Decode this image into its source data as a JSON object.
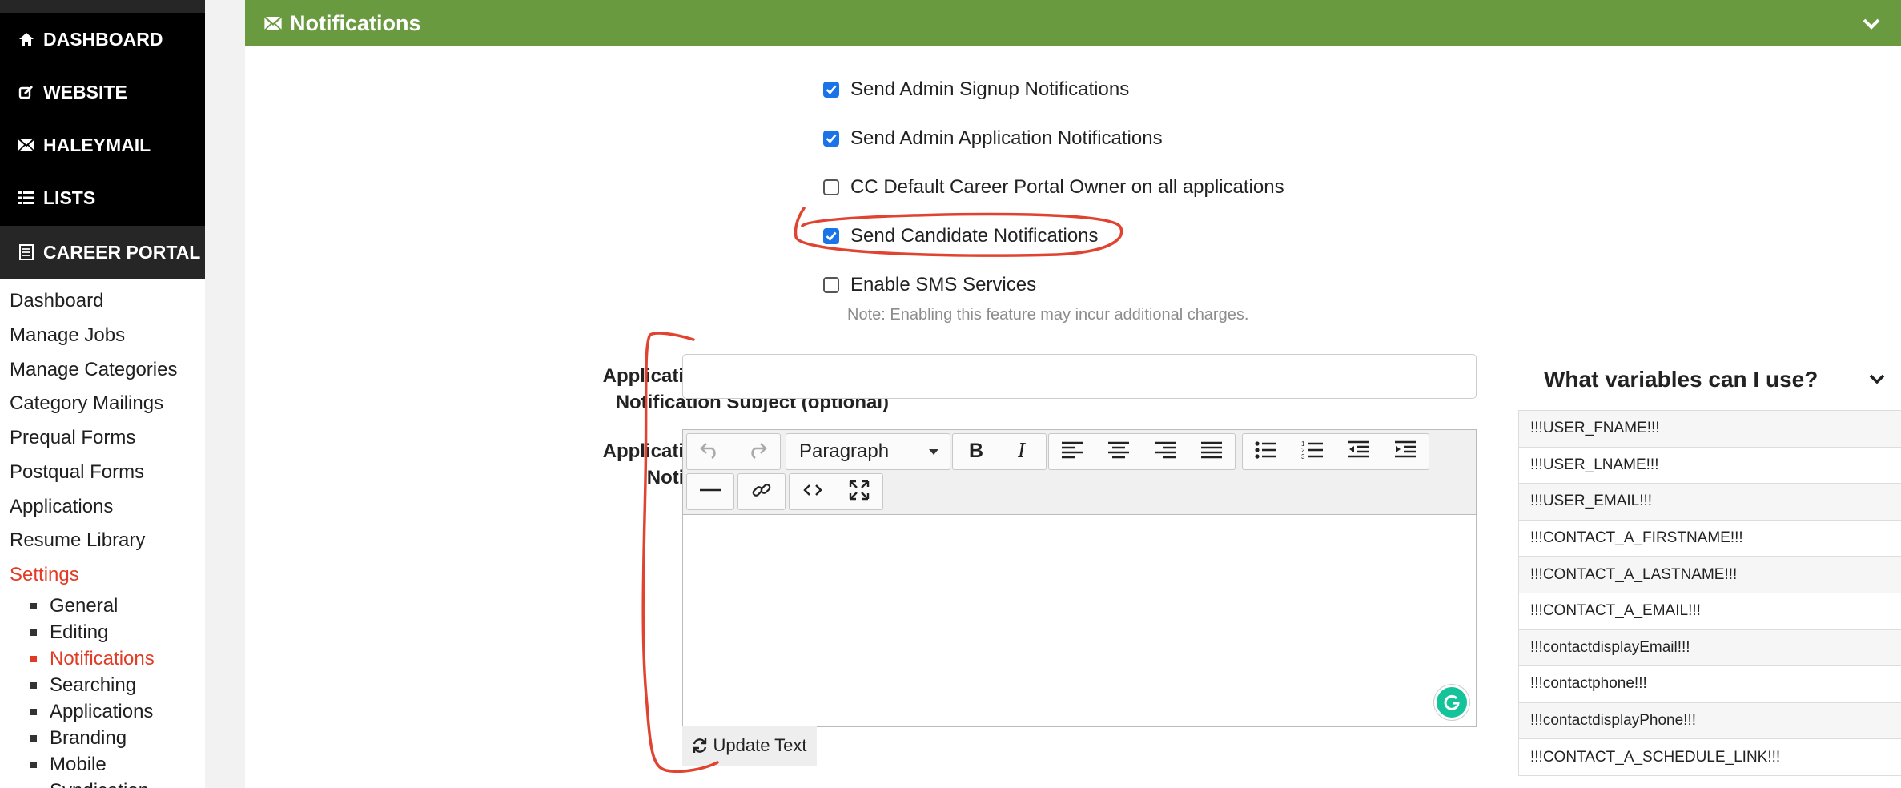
{
  "sidebar": {
    "main_nav": [
      {
        "label": "DASHBOARD",
        "icon": "home-icon"
      },
      {
        "label": "WEBSITE",
        "icon": "edit-icon"
      },
      {
        "label": "HALEYMAIL",
        "icon": "mail-icon"
      },
      {
        "label": "LISTS",
        "icon": "list-icon"
      },
      {
        "label": "CAREER PORTAL",
        "icon": "document-icon",
        "active": true
      }
    ],
    "sub_nav": [
      "Dashboard",
      "Manage Jobs",
      "Manage Categories",
      "Category Mailings",
      "Prequal Forms",
      "Postqual Forms",
      "Applications",
      "Resume Library",
      "Settings"
    ],
    "settings_items": [
      "General",
      "Editing",
      "Notifications",
      "Searching",
      "Applications",
      "Branding",
      "Mobile",
      "Syndication"
    ],
    "active_color": "#e23a24"
  },
  "panel": {
    "title": "Notifications",
    "header_color": "#6a9a40",
    "checkboxes": [
      {
        "label": "Send Admin Signup Notifications",
        "checked": true
      },
      {
        "label": "Send Admin Application Notifications",
        "checked": true
      },
      {
        "label": "CC Default Career Portal Owner on all applications",
        "checked": false
      },
      {
        "label": "Send Candidate Notifications",
        "checked": true
      },
      {
        "label": "Enable SMS Services",
        "checked": false
      }
    ],
    "sms_note": "Note: Enabling this feature may incur additional charges.",
    "subject_label_line1": "Application Confirmation Email",
    "subject_label_line2": "Notification Subject (optional)",
    "subject_value": "",
    "text_label_line1": "Application Confirmation Email",
    "text_label_line2": "Notification Text (optional)",
    "editor": {
      "format_value": "Paragraph",
      "body": ""
    },
    "update_button": "Update Text",
    "variables_title": "What variables can I use?",
    "variables": [
      "!!!USER_FNAME!!!",
      "!!!USER_LNAME!!!",
      "!!!USER_EMAIL!!!",
      "!!!CONTACT_A_FIRSTNAME!!!",
      "!!!CONTACT_A_LASTNAME!!!",
      "!!!CONTACT_A_EMAIL!!!",
      "!!!contactdisplayEmail!!!",
      "!!!contactphone!!!",
      "!!!contactdisplayPhone!!!",
      "!!!CONTACT_A_SCHEDULE_LINK!!!"
    ],
    "annotation_color": "#e0432f"
  }
}
